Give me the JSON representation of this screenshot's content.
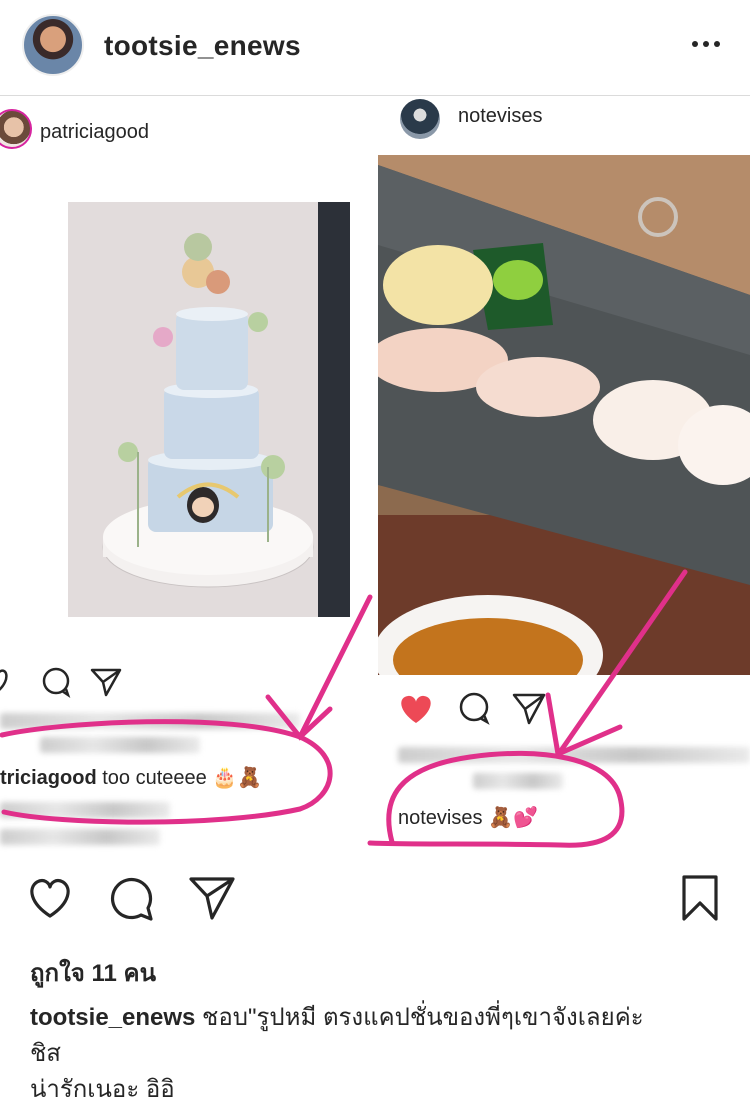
{
  "header": {
    "username": "tootsie_enews",
    "more_icon": "more-horizontal-icon"
  },
  "collage": {
    "left_post": {
      "username": "patriciagood",
      "comment_user": "tricia good",
      "comment_user_display": "triciagood",
      "comment_text": "too cuteeee",
      "comment_emojis": "🎂🧸"
    },
    "right_post": {
      "username": "notevises",
      "comment_user": "notevises",
      "comment_emojis": "🧸💕",
      "like_color": "#ed4956"
    },
    "annotation_color": "#e0308a"
  },
  "actions": {
    "like_icon": "heart-icon",
    "comment_icon": "comment-icon",
    "share_icon": "send-icon",
    "save_icon": "bookmark-icon"
  },
  "likes_text": "ถูกใจ 11 คน",
  "caption": {
    "username": "tootsie_enews",
    "line1": " ชอบ\"รูปหมี ตรงแคปชั่นของพี่ๆเขาจังเลยค่ะ",
    "line2": "ชิส",
    "line3": "น่ารักเนอะ อิอิ"
  }
}
